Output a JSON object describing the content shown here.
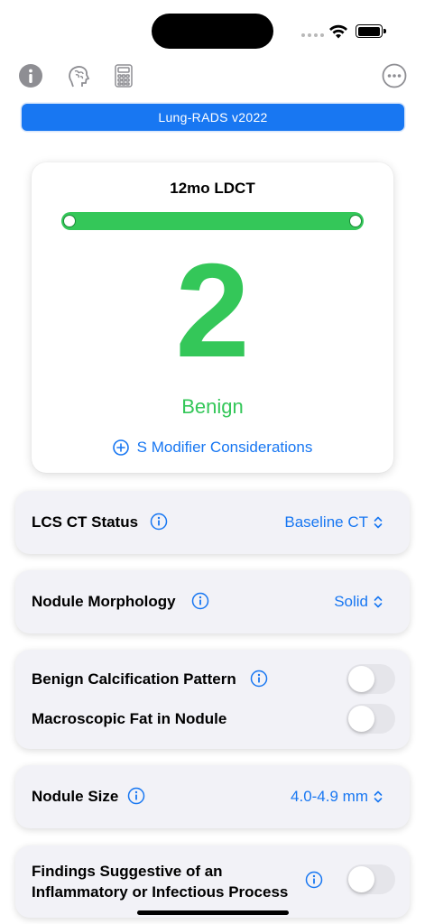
{
  "banner": {
    "label": "Lung-RADS v2022"
  },
  "result": {
    "title": "12mo LDCT",
    "score": "2",
    "category": "Benign",
    "modifier_link": "S Modifier Considerations"
  },
  "settings": {
    "ct_status": {
      "label": "LCS CT Status",
      "value": "Baseline CT"
    },
    "morphology": {
      "label": "Nodule Morphology",
      "value": "Solid"
    },
    "calcification": {
      "label": "Benign Calcification Pattern",
      "on": false
    },
    "fat": {
      "label": "Macroscopic Fat in Nodule",
      "on": false
    },
    "size": {
      "label": "Nodule Size",
      "value": "4.0-4.9 mm"
    },
    "inflammatory": {
      "label_line1": "Findings Suggestive of an",
      "label_line2": "Inflammatory or Infectious Process",
      "on": false
    }
  },
  "icons": [
    "info-icon",
    "brain-head-icon",
    "calculator-icon",
    "more-icon",
    "plus-circle-icon",
    "chevron-updown-icon"
  ],
  "colors": {
    "accent": "#1877f2",
    "success": "#34c759",
    "card_bg": "#f2f2f7",
    "toggle_off": "#e5e5ea"
  }
}
